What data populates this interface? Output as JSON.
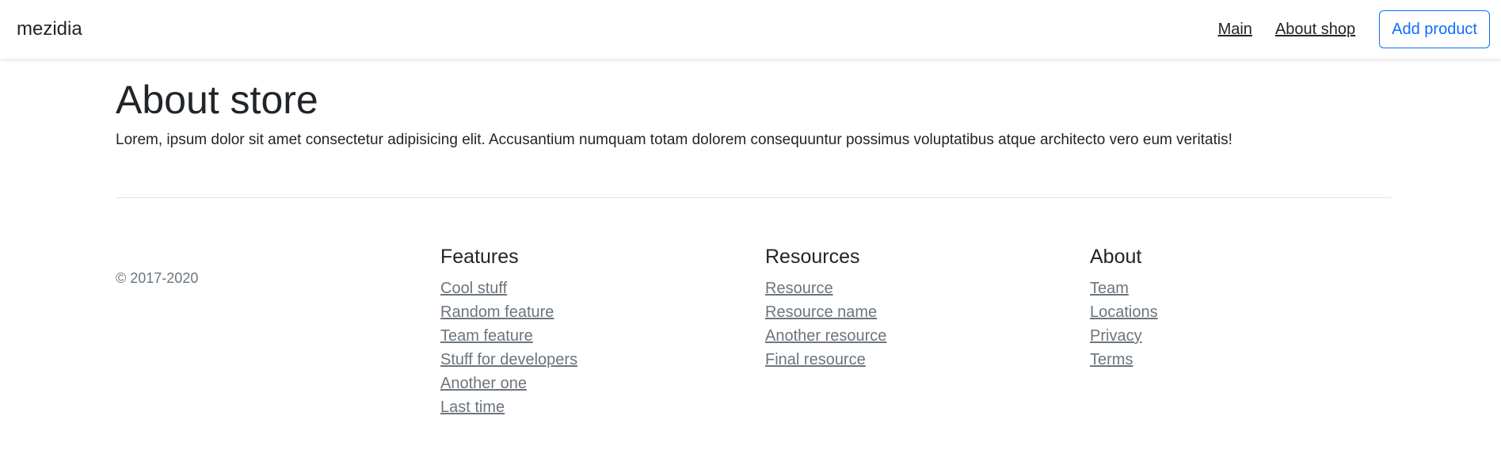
{
  "navbar": {
    "brand": "mezidia",
    "links": [
      "Main",
      "About shop"
    ],
    "add_button": "Add product"
  },
  "main": {
    "title": "About store",
    "description": "Lorem, ipsum dolor sit amet consectetur adipisicing elit. Accusantium numquam totam dolorem consequuntur possimus voluptatibus atque architecto vero eum veritatis!"
  },
  "footer": {
    "copyright": "© 2017-2020",
    "columns": [
      {
        "heading": "Features",
        "links": [
          "Cool stuff",
          "Random feature",
          "Team feature",
          "Stuff for developers",
          "Another one",
          "Last time"
        ]
      },
      {
        "heading": "Resources",
        "links": [
          "Resource",
          "Resource name",
          "Another resource",
          "Final resource"
        ]
      },
      {
        "heading": "About",
        "links": [
          "Team",
          "Locations",
          "Privacy",
          "Terms"
        ]
      }
    ]
  },
  "colors": {
    "accent": "#0d6efd",
    "text": "#212529",
    "muted": "#6c757d",
    "divider": "#dee2e6"
  }
}
